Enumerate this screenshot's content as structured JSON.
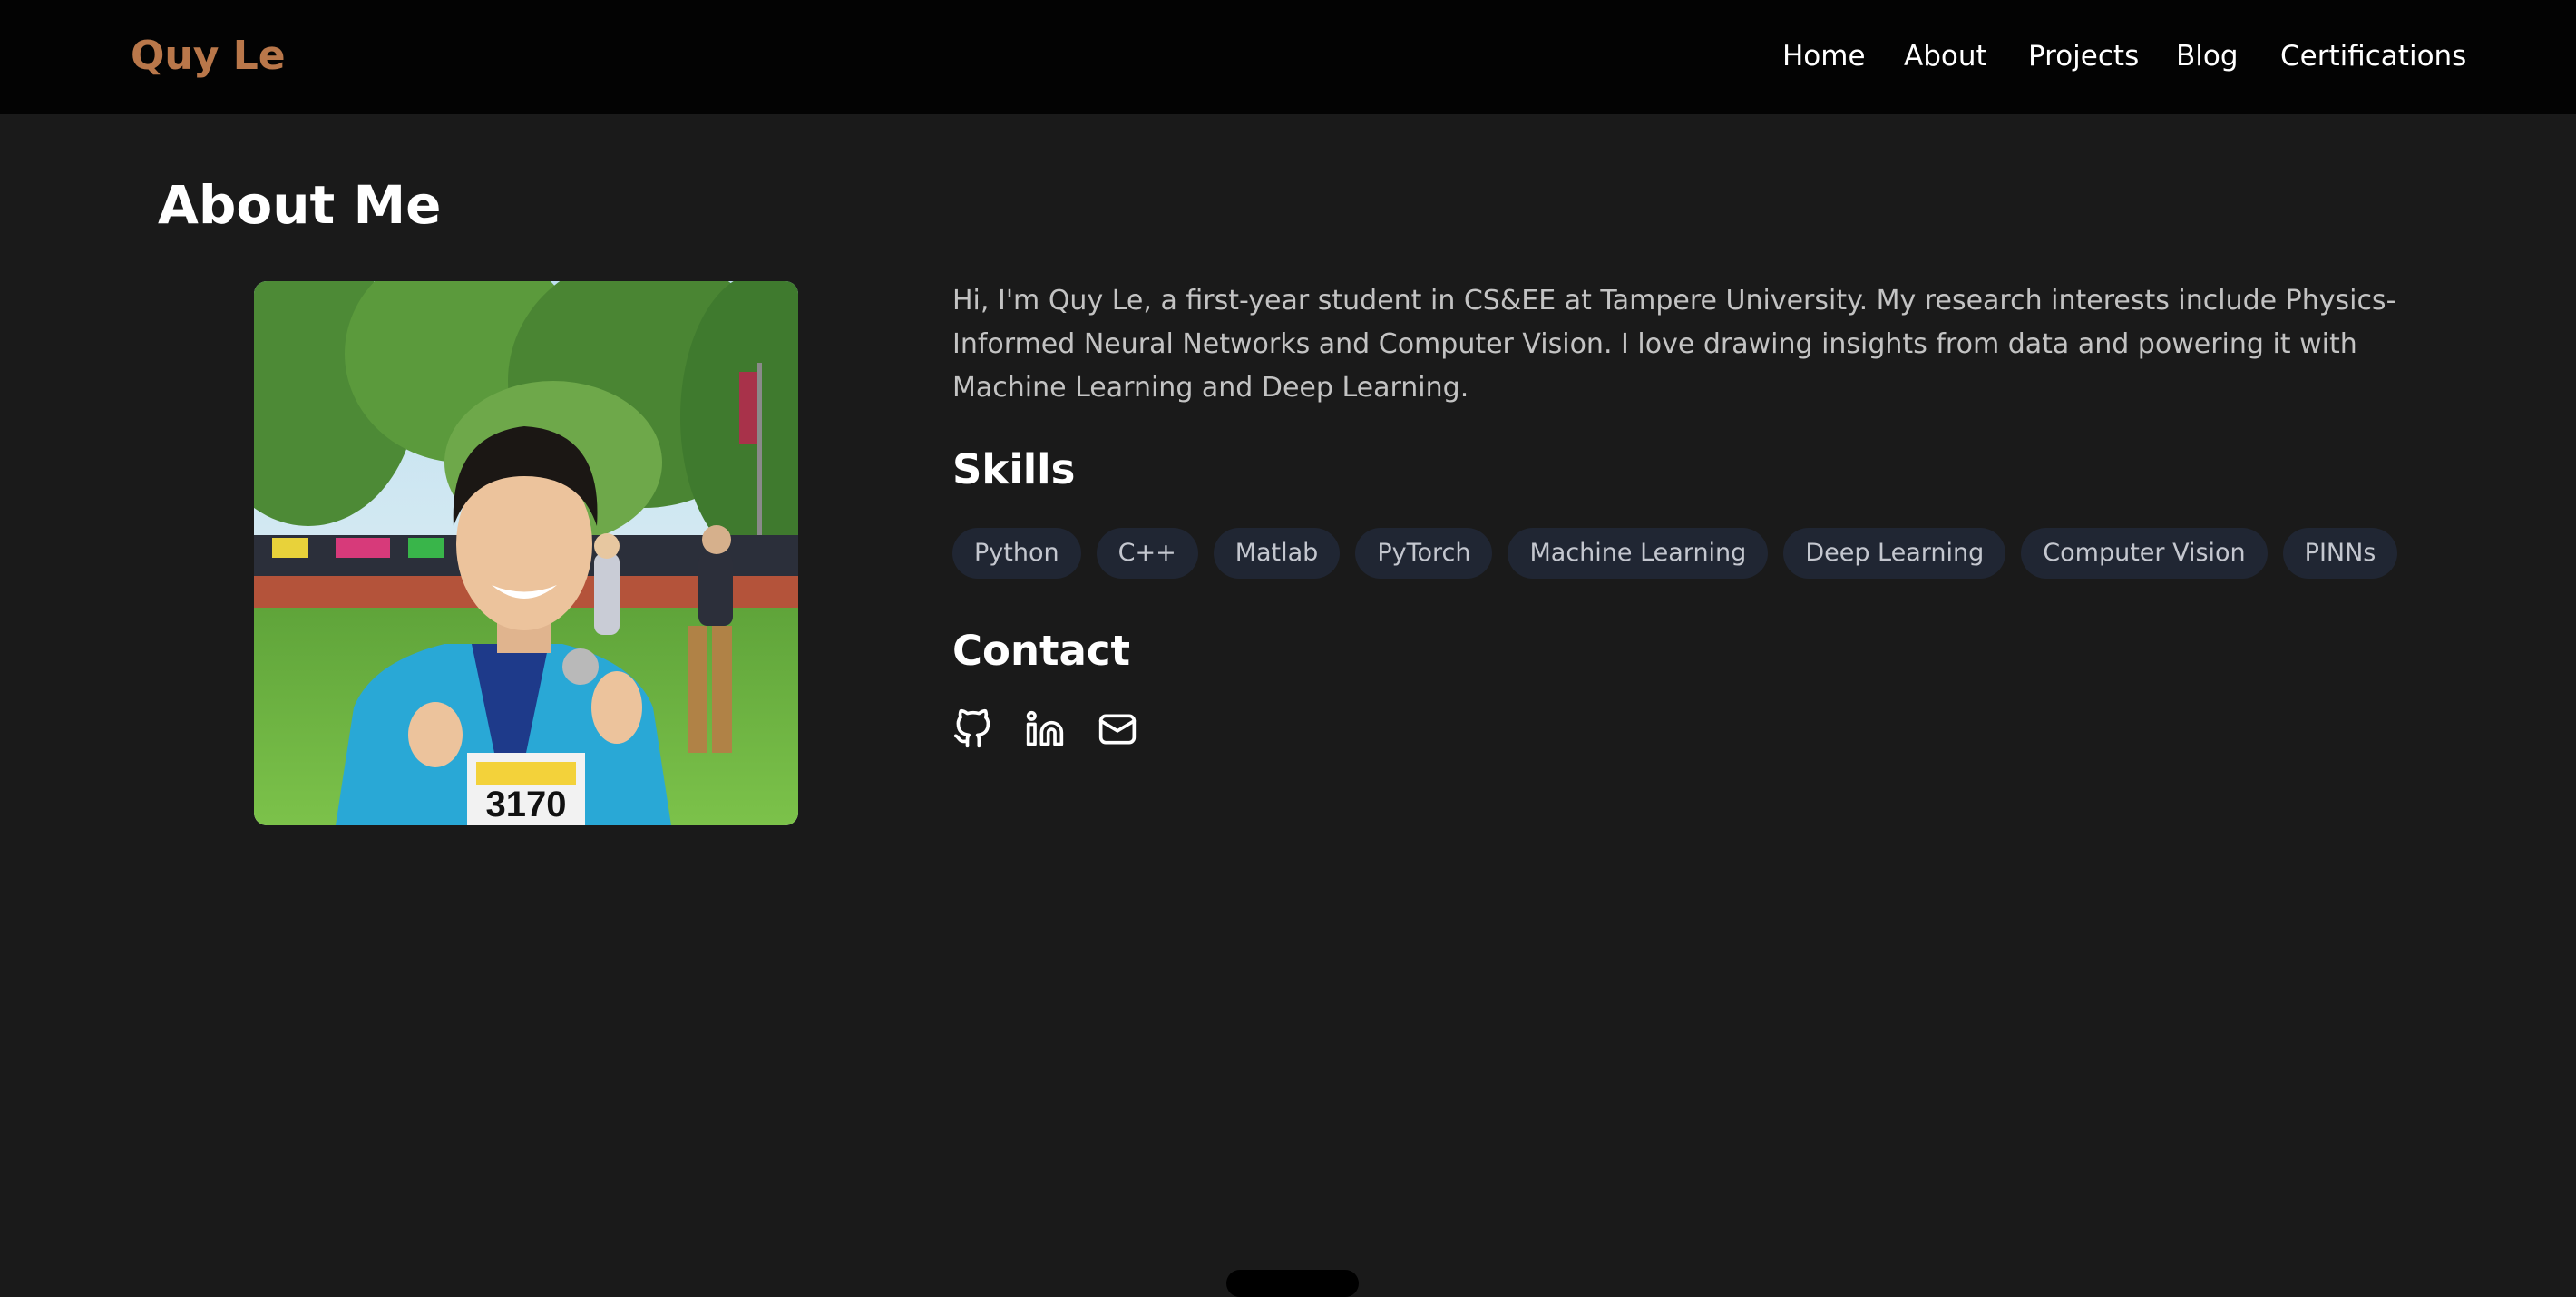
{
  "header": {
    "brand": "Quy Le",
    "brand_color": "#b9774a",
    "nav": [
      {
        "label": "Home"
      },
      {
        "label": "About"
      },
      {
        "label": "Projects"
      },
      {
        "label": "Blog"
      },
      {
        "label": "Certifications"
      }
    ]
  },
  "about": {
    "title": "About Me",
    "photo_icon": "profile-photo",
    "bio": "Hi, I'm Quy Le, a first-year student in CS&EE at Tampere University. My research interests include Physics-Informed Neural Networks and Computer Vision. I love drawing insights from data and powering it with Machine Learning and Deep Learning."
  },
  "skills": {
    "title": "Skills",
    "items": [
      "Python",
      "C++",
      "Matlab",
      "PyTorch",
      "Machine Learning",
      "Deep Learning",
      "Computer Vision",
      "PINNs"
    ]
  },
  "contact": {
    "title": "Contact",
    "links": [
      {
        "icon": "github-icon"
      },
      {
        "icon": "linkedin-icon"
      },
      {
        "icon": "mail-icon"
      }
    ]
  },
  "colors": {
    "background": "#1a1a1a",
    "navbar": "#030303",
    "chip_background": "#202633",
    "bio_text": "#c3c3c3"
  }
}
